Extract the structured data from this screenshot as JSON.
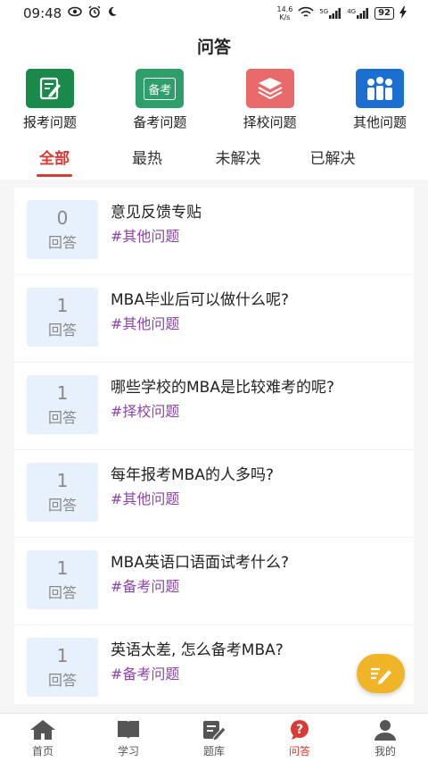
{
  "status": {
    "time": "09:48",
    "net_speed_value": "14.6",
    "net_speed_unit": "K/s",
    "signal_1": "5G",
    "signal_2": "4G",
    "battery": "92"
  },
  "header": {
    "title": "问答"
  },
  "categories": [
    {
      "label": "报考问题",
      "icon": "notebook-pen-icon",
      "color": "#1a8a4a"
    },
    {
      "label": "备考问题",
      "icon": "prep-exam-icon",
      "icon_text": "备考",
      "color": "#2e9e6b"
    },
    {
      "label": "择校问题",
      "icon": "books-stack-icon",
      "color": "#e86a6a"
    },
    {
      "label": "其他问题",
      "icon": "people-group-icon",
      "color": "#1b6fd0"
    }
  ],
  "tabs": [
    {
      "label": "全部",
      "active": true
    },
    {
      "label": "最热"
    },
    {
      "label": "未解决"
    },
    {
      "label": "已解决"
    }
  ],
  "questions": [
    {
      "count": "0",
      "count_label": "回答",
      "title": "意见反馈专贴",
      "tag": "#其他问题"
    },
    {
      "count": "1",
      "count_label": "回答",
      "title": "MBA毕业后可以做什么呢?",
      "tag": "#其他问题"
    },
    {
      "count": "1",
      "count_label": "回答",
      "title": "哪些学校的MBA是比较难考的呢?",
      "tag": "#择校问题"
    },
    {
      "count": "1",
      "count_label": "回答",
      "title": "每年报考MBA的人多吗?",
      "tag": "#其他问题"
    },
    {
      "count": "1",
      "count_label": "回答",
      "title": "MBA英语口语面试考什么?",
      "tag": "#备考问题"
    },
    {
      "count": "1",
      "count_label": "回答",
      "title": "英语太差, 怎么备考MBA?",
      "tag": "#备考问题"
    }
  ],
  "bottom_nav": [
    {
      "label": "首页",
      "icon": "home-icon"
    },
    {
      "label": "学习",
      "icon": "book-icon"
    },
    {
      "label": "题库",
      "icon": "question-bank-icon"
    },
    {
      "label": "问答",
      "icon": "question-mark-icon",
      "active": true
    },
    {
      "label": "我的",
      "icon": "profile-icon"
    }
  ],
  "colors": {
    "accent": "#d93a34",
    "tag": "#8e44ad",
    "count_bg": "#e6f1fb",
    "fab": "#f0b429"
  }
}
